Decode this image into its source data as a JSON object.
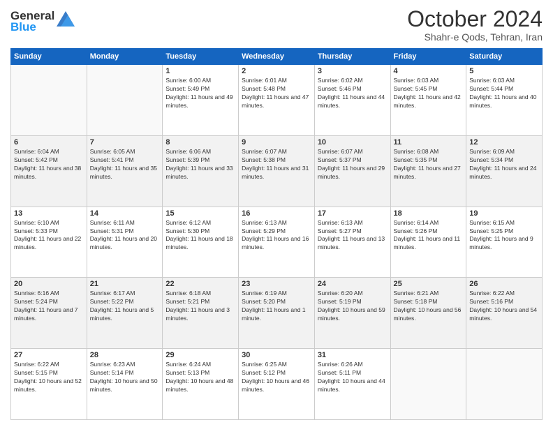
{
  "header": {
    "logo_line1": "General",
    "logo_line2": "Blue",
    "month": "October 2024",
    "location": "Shahr-e Qods, Tehran, Iran"
  },
  "weekdays": [
    "Sunday",
    "Monday",
    "Tuesday",
    "Wednesday",
    "Thursday",
    "Friday",
    "Saturday"
  ],
  "weeks": [
    [
      {
        "day": "",
        "text": ""
      },
      {
        "day": "",
        "text": ""
      },
      {
        "day": "1",
        "text": "Sunrise: 6:00 AM\nSunset: 5:49 PM\nDaylight: 11 hours and 49 minutes."
      },
      {
        "day": "2",
        "text": "Sunrise: 6:01 AM\nSunset: 5:48 PM\nDaylight: 11 hours and 47 minutes."
      },
      {
        "day": "3",
        "text": "Sunrise: 6:02 AM\nSunset: 5:46 PM\nDaylight: 11 hours and 44 minutes."
      },
      {
        "day": "4",
        "text": "Sunrise: 6:03 AM\nSunset: 5:45 PM\nDaylight: 11 hours and 42 minutes."
      },
      {
        "day": "5",
        "text": "Sunrise: 6:03 AM\nSunset: 5:44 PM\nDaylight: 11 hours and 40 minutes."
      }
    ],
    [
      {
        "day": "6",
        "text": "Sunrise: 6:04 AM\nSunset: 5:42 PM\nDaylight: 11 hours and 38 minutes."
      },
      {
        "day": "7",
        "text": "Sunrise: 6:05 AM\nSunset: 5:41 PM\nDaylight: 11 hours and 35 minutes."
      },
      {
        "day": "8",
        "text": "Sunrise: 6:06 AM\nSunset: 5:39 PM\nDaylight: 11 hours and 33 minutes."
      },
      {
        "day": "9",
        "text": "Sunrise: 6:07 AM\nSunset: 5:38 PM\nDaylight: 11 hours and 31 minutes."
      },
      {
        "day": "10",
        "text": "Sunrise: 6:07 AM\nSunset: 5:37 PM\nDaylight: 11 hours and 29 minutes."
      },
      {
        "day": "11",
        "text": "Sunrise: 6:08 AM\nSunset: 5:35 PM\nDaylight: 11 hours and 27 minutes."
      },
      {
        "day": "12",
        "text": "Sunrise: 6:09 AM\nSunset: 5:34 PM\nDaylight: 11 hours and 24 minutes."
      }
    ],
    [
      {
        "day": "13",
        "text": "Sunrise: 6:10 AM\nSunset: 5:33 PM\nDaylight: 11 hours and 22 minutes."
      },
      {
        "day": "14",
        "text": "Sunrise: 6:11 AM\nSunset: 5:31 PM\nDaylight: 11 hours and 20 minutes."
      },
      {
        "day": "15",
        "text": "Sunrise: 6:12 AM\nSunset: 5:30 PM\nDaylight: 11 hours and 18 minutes."
      },
      {
        "day": "16",
        "text": "Sunrise: 6:13 AM\nSunset: 5:29 PM\nDaylight: 11 hours and 16 minutes."
      },
      {
        "day": "17",
        "text": "Sunrise: 6:13 AM\nSunset: 5:27 PM\nDaylight: 11 hours and 13 minutes."
      },
      {
        "day": "18",
        "text": "Sunrise: 6:14 AM\nSunset: 5:26 PM\nDaylight: 11 hours and 11 minutes."
      },
      {
        "day": "19",
        "text": "Sunrise: 6:15 AM\nSunset: 5:25 PM\nDaylight: 11 hours and 9 minutes."
      }
    ],
    [
      {
        "day": "20",
        "text": "Sunrise: 6:16 AM\nSunset: 5:24 PM\nDaylight: 11 hours and 7 minutes."
      },
      {
        "day": "21",
        "text": "Sunrise: 6:17 AM\nSunset: 5:22 PM\nDaylight: 11 hours and 5 minutes."
      },
      {
        "day": "22",
        "text": "Sunrise: 6:18 AM\nSunset: 5:21 PM\nDaylight: 11 hours and 3 minutes."
      },
      {
        "day": "23",
        "text": "Sunrise: 6:19 AM\nSunset: 5:20 PM\nDaylight: 11 hours and 1 minute."
      },
      {
        "day": "24",
        "text": "Sunrise: 6:20 AM\nSunset: 5:19 PM\nDaylight: 10 hours and 59 minutes."
      },
      {
        "day": "25",
        "text": "Sunrise: 6:21 AM\nSunset: 5:18 PM\nDaylight: 10 hours and 56 minutes."
      },
      {
        "day": "26",
        "text": "Sunrise: 6:22 AM\nSunset: 5:16 PM\nDaylight: 10 hours and 54 minutes."
      }
    ],
    [
      {
        "day": "27",
        "text": "Sunrise: 6:22 AM\nSunset: 5:15 PM\nDaylight: 10 hours and 52 minutes."
      },
      {
        "day": "28",
        "text": "Sunrise: 6:23 AM\nSunset: 5:14 PM\nDaylight: 10 hours and 50 minutes."
      },
      {
        "day": "29",
        "text": "Sunrise: 6:24 AM\nSunset: 5:13 PM\nDaylight: 10 hours and 48 minutes."
      },
      {
        "day": "30",
        "text": "Sunrise: 6:25 AM\nSunset: 5:12 PM\nDaylight: 10 hours and 46 minutes."
      },
      {
        "day": "31",
        "text": "Sunrise: 6:26 AM\nSunset: 5:11 PM\nDaylight: 10 hours and 44 minutes."
      },
      {
        "day": "",
        "text": ""
      },
      {
        "day": "",
        "text": ""
      }
    ]
  ]
}
